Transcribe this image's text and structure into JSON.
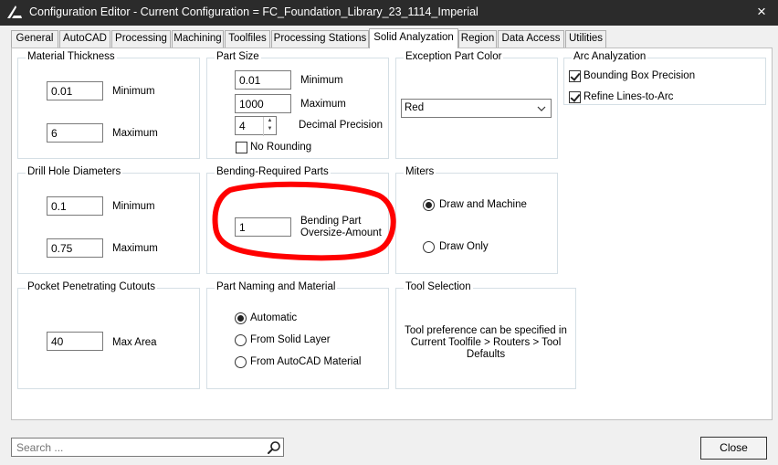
{
  "window": {
    "title": "Configuration Editor - Current Configuration = FC_Foundation_Library_23_1114_Imperial",
    "close_icon": "×"
  },
  "tabs": [
    {
      "label": "General"
    },
    {
      "label": "AutoCAD"
    },
    {
      "label": "Processing"
    },
    {
      "label": "Machining"
    },
    {
      "label": "Toolfiles"
    },
    {
      "label": "Processing Stations"
    },
    {
      "label": "Solid Analyzation",
      "active": true
    },
    {
      "label": "Region"
    },
    {
      "label": "Data Access"
    },
    {
      "label": "Utilities"
    }
  ],
  "material_thickness": {
    "title": "Material Thickness",
    "min_value": "0.01",
    "min_label": "Minimum",
    "max_value": "6",
    "max_label": "Maximum"
  },
  "part_size": {
    "title": "Part Size",
    "min_value": "0.01",
    "min_label": "Minimum",
    "max_value": "1000",
    "max_label": "Maximum",
    "precision_value": "4",
    "precision_label": "Decimal Precision",
    "no_rounding_label": "No Rounding",
    "no_rounding_checked": false
  },
  "exception_color": {
    "title": "Exception Part Color",
    "selected": "Red"
  },
  "arc_analyzation": {
    "title": "Arc Analyzation",
    "bbox_label": "Bounding Box Precision",
    "bbox_checked": true,
    "refine_label": "Refine Lines-to-Arc",
    "refine_checked": true
  },
  "drill_hole": {
    "title": "Drill Hole Diameters",
    "min_value": "0.1",
    "min_label": "Minimum",
    "max_value": "0.75",
    "max_label": "Maximum"
  },
  "bending": {
    "title": "Bending-Required Parts",
    "value": "1",
    "label_line1": "Bending Part",
    "label_line2": "Oversize-Amount"
  },
  "miters": {
    "title": "Miters",
    "opt1": "Draw and Machine",
    "opt2": "Draw Only",
    "selected": "Draw and Machine"
  },
  "pocket": {
    "title": "Pocket Penetrating Cutouts",
    "value": "40",
    "label": "Max Area"
  },
  "part_naming": {
    "title": "Part Naming and Material",
    "opt1": "Automatic",
    "opt2": "From Solid Layer",
    "opt3": "From AutoCAD Material",
    "selected": "Automatic"
  },
  "tool_selection": {
    "title": "Tool Selection",
    "line1": "Tool preference can be specified in",
    "line2": "Current Toolfile > Routers > Tool",
    "line3": "Defaults"
  },
  "footer": {
    "search_placeholder": "Search ...",
    "close_label": "Close"
  },
  "colors": {
    "titlebar": "#2b2b2b",
    "annotation": "#ff0000"
  }
}
